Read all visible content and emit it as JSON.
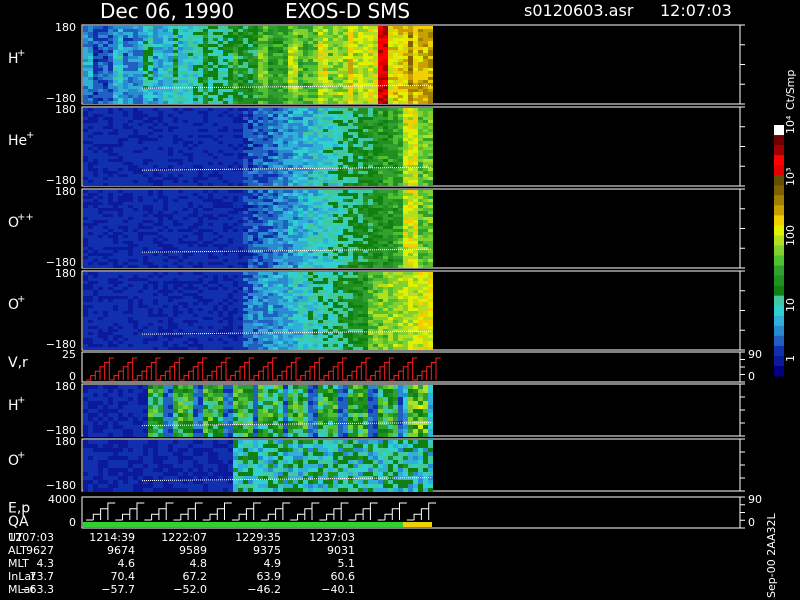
{
  "header": {
    "date": "Dec 06, 1990",
    "instrument": "EXOS-D SMS",
    "file_id": "s0120603.asr",
    "time": "12:07:03"
  },
  "chart_data": {
    "type": "heatmap",
    "colorbar": {
      "label": "Ct/Smp",
      "ticks": [
        "1",
        "10",
        "100",
        "10³",
        "10⁴"
      ],
      "colors": [
        "#000080",
        "#0a1a9a",
        "#1030b0",
        "#2060c0",
        "#2a8ad0",
        "#30b0d8",
        "#30d0d0",
        "#40c8a0",
        "#108010",
        "#209020",
        "#30a030",
        "#50c030",
        "#80d030",
        "#b0e020",
        "#e0f000",
        "#f0d000",
        "#c8a000",
        "#a08000",
        "#806000",
        "#605000",
        "#e00000",
        "#ff0000",
        "#a00000",
        "#700000",
        "#ffffff"
      ]
    },
    "panels": [
      {
        "label_main": "H",
        "label_sup": "+",
        "ymax": "180",
        "ymin": "−180",
        "kind": "h1"
      },
      {
        "label_main": "He",
        "label_sup": "+",
        "ymax": "180",
        "ymin": "−180",
        "kind": "he"
      },
      {
        "label_main": "O",
        "label_sup": "++",
        "ymax": "180",
        "ymin": "−180",
        "kind": "opp"
      },
      {
        "label_main": "O",
        "label_sup": "+",
        "ymax": "180",
        "ymin": "−180",
        "kind": "op"
      },
      {
        "label_main": "V,r",
        "label_sup": "",
        "ymax": "25",
        "ymin": "0",
        "kind": "line",
        "right_top": "90",
        "right_bot": "0"
      },
      {
        "label_main": "H",
        "label_sup": "+",
        "ymax": "180",
        "ymin": "−180",
        "kind": "h2"
      },
      {
        "label_main": "O",
        "label_sup": "+",
        "ymax": "180",
        "ymin": "−180",
        "kind": "o2"
      },
      {
        "label_main": "E,p",
        "label_sup": "",
        "label2": "QA",
        "ymax": "4000",
        "ymin": "0",
        "kind": "step",
        "right_top": "90",
        "right_bot": "0"
      }
    ],
    "time_axis": {
      "row_labels": [
        "UT",
        "ALT",
        "MLT",
        "InLat",
        "MLat"
      ],
      "columns": [
        {
          "UT": "1207:03",
          "ALT": "9627",
          "MLT": "4.3",
          "InLat": "73.7",
          "MLat": "−63.3"
        },
        {
          "UT": "1214:39",
          "ALT": "9674",
          "MLT": "4.6",
          "InLat": "70.4",
          "MLat": "−57.7"
        },
        {
          "UT": "1222:07",
          "ALT": "9589",
          "MLT": "4.8",
          "InLat": "67.2",
          "MLat": "−52.0"
        },
        {
          "UT": "1229:35",
          "ALT": "9375",
          "MLT": "4.9",
          "InLat": "63.9",
          "MLat": "−46.2"
        },
        {
          "UT": "1237:03",
          "ALT": "9031",
          "MLT": "5.1",
          "InLat": "60.6",
          "MLat": "−40.1"
        }
      ]
    },
    "footer_code": "Sep-00 2AA32L"
  }
}
